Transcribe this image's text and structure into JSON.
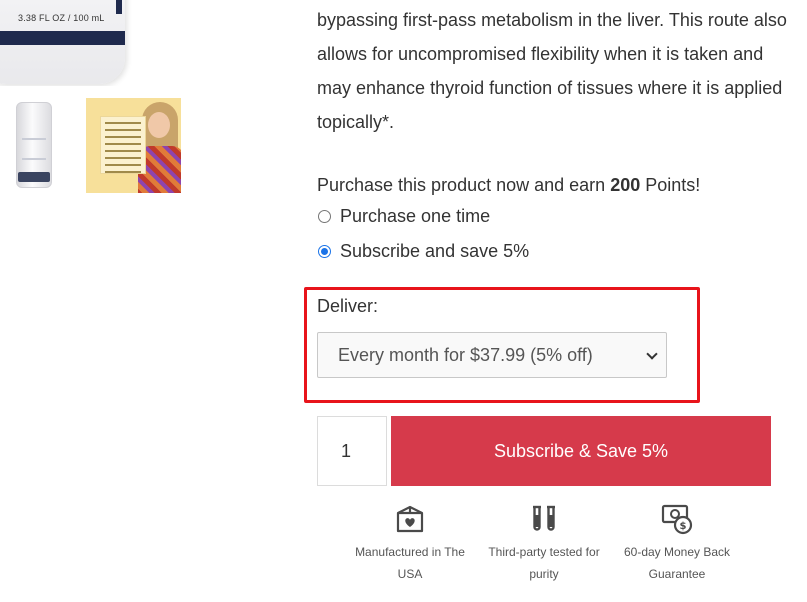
{
  "gallery": {
    "bottle_label": "3.38 FL OZ / 100 mL",
    "thumbnails": [
      "product-pump-bottle",
      "approved-for-list-card"
    ]
  },
  "product": {
    "description": "bypassing first-pass metabolism in the liver. This route also allows for uncompromised flexibility when it is taken and may enhance thyroid function of tissues where it is applied topically*.",
    "points_prefix": "Purchase this product now and earn",
    "points_value": "200",
    "points_suffix": "Points!"
  },
  "purchase_options": [
    {
      "label": "Purchase one time",
      "selected": false
    },
    {
      "label": "Subscribe and save 5%",
      "selected": true
    }
  ],
  "deliver": {
    "label": "Deliver:",
    "selected_option": "Every month for $37.99 (5% off)"
  },
  "cart": {
    "quantity": "1",
    "button_label": "Subscribe & Save 5%",
    "button_color": "#d63a4b"
  },
  "badges": [
    {
      "icon": "heart-box-icon",
      "label": "Manufactured in The USA"
    },
    {
      "icon": "test-tubes-icon",
      "label": "Third-party tested for purity"
    },
    {
      "icon": "money-back-icon",
      "label": "60-day Money Back Guarantee"
    }
  ],
  "colors": {
    "highlight_border": "#e8141b",
    "radio_accent": "#1a73e8"
  }
}
